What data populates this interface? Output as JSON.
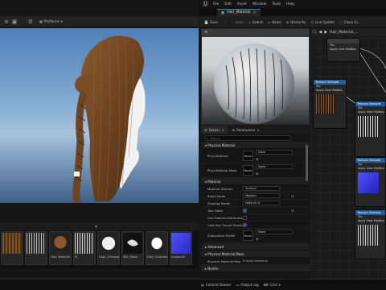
{
  "left_toolbar": {
    "platforms_label": "Platforms"
  },
  "content_browser": {
    "assets": [
      {
        "label": "",
        "color": "#6b4a2a"
      },
      {
        "label": "",
        "color": "#3b3b3b"
      },
      {
        "label": "Hair_Material",
        "color": "#7a5532"
      },
      {
        "label": "M_",
        "color": "#444444"
      },
      {
        "label": "Logo_Transparent",
        "color": "#e8e8e8"
      },
      {
        "label": "Skin_Base",
        "color": "#1a1a1a"
      },
      {
        "label": "Hair_Flowmap",
        "color": "#ffffff"
      },
      {
        "label": "mapbuild",
        "color": "#3b3be0"
      },
      {
        "label": "",
        "color": "#555555"
      }
    ]
  },
  "material_editor": {
    "menu": [
      "File",
      "Edit",
      "Asset",
      "Window",
      "Tools",
      "Help"
    ],
    "tab_title": "Hair_Material",
    "toolbar": {
      "save": "Save",
      "apply": "Apply",
      "search": "Search",
      "home": "Home",
      "hierarchy": "Hierarchy",
      "live_update": "Live Update",
      "clean_graph": "Clean Gr..."
    },
    "graph_tab": "Hair_Material_...",
    "nodes": [
      {
        "title": "",
        "pins": [
          "Yes",
          "Apply View MipBias"
        ],
        "header_color": "#3a3a3a"
      },
      {
        "title": "Texture Sample",
        "pins": [
          "Tex",
          "Apply View MipBias"
        ],
        "header_color": "#1f5fa0"
      },
      {
        "title": "Texture Sample",
        "pins": [
          "Tex",
          "Apply View MipBias"
        ],
        "header_color": "#1f5fa0"
      },
      {
        "title": "Texture Sample",
        "pins": [
          "Tex",
          "Apply View MipBias"
        ],
        "header_color": "#1f5fa0"
      },
      {
        "title": "Texture Sample",
        "pins": [
          "Tex",
          "Apply View MipBias"
        ],
        "header_color": "#1f5fa0"
      }
    ],
    "details_tabs": {
      "details": "Details",
      "parameters": "Parameters"
    },
    "search_placeholder": "Search",
    "sections": {
      "physical_material": "Physical Material",
      "material": "Material",
      "advanced": "Advanced",
      "physical_material_mask": "Physical Material Mask",
      "nanite": "Nanite"
    },
    "props": {
      "phys_material": "Phys Material",
      "phys_material_mask": "Phys Material Mask",
      "none": "None",
      "material_domain": "Material Domain",
      "material_domain_val": "Surface",
      "blend_mode": "Blend Mode",
      "blend_mode_val": "Masked",
      "shading_model": "Shading Model",
      "shading_model_val": "Default Lit",
      "two_sided": "Two Sided",
      "use_material_attributes": "Use Material Attributes",
      "cast_ray_traced_shadows": "Cast Ray Traced Shado",
      "subsurface_profile": "Subsurface Profile",
      "physical_material_map": "Physical Material Map",
      "physical_material_map_val": "8 Array elements"
    }
  },
  "statusbar": {
    "content_drawer": "Content Drawer",
    "output_log": "Output Log",
    "cmd": "Cmd"
  }
}
